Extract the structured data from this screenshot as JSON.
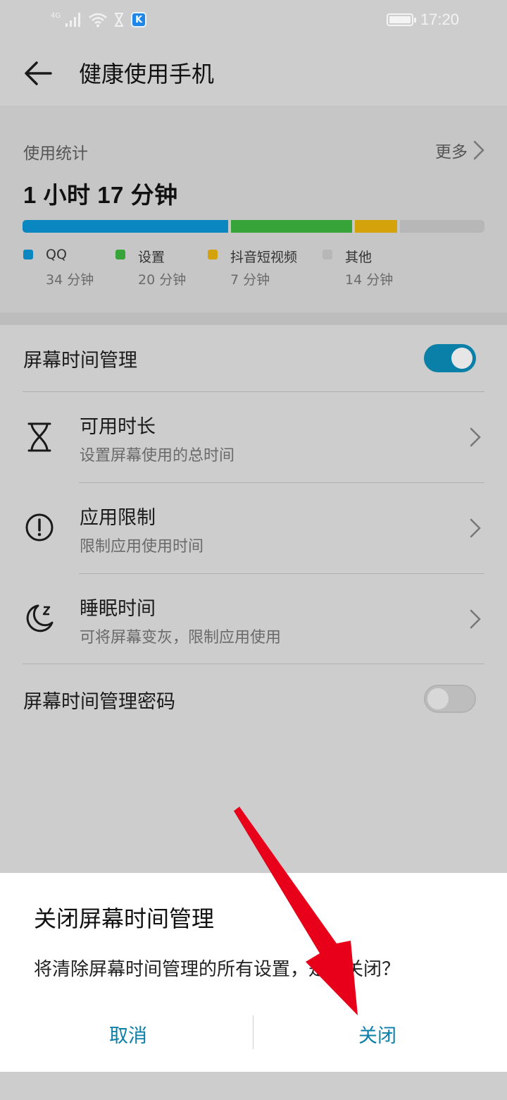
{
  "status_bar": {
    "network": "4G",
    "time": "17:20",
    "icons": [
      "signal-icon",
      "wifi-icon",
      "hourglass-icon",
      "k-app-icon",
      "battery-icon"
    ]
  },
  "header": {
    "title": "健康使用手机",
    "back_icon": "back-arrow-icon"
  },
  "usage": {
    "label": "使用统计",
    "more": "更多",
    "total": "1 小时 17 分钟",
    "apps": [
      {
        "name": "QQ",
        "time": "34 分钟",
        "minutes": 34,
        "color": "#0a86c0"
      },
      {
        "name": "设置",
        "time": "20 分钟",
        "minutes": 20,
        "color": "#37a43a"
      },
      {
        "name": "抖音短视频",
        "time": "7 分钟",
        "minutes": 7,
        "color": "#d4a20a"
      },
      {
        "name": "其他",
        "time": "14 分钟",
        "minutes": 14,
        "color": "#b7b7b7"
      }
    ]
  },
  "settings": {
    "screen_time": {
      "label": "屏幕时间管理",
      "enabled": true
    },
    "items": [
      {
        "title": "可用时长",
        "subtitle": "设置屏幕使用的总时间",
        "icon": "hourglass-icon"
      },
      {
        "title": "应用限制",
        "subtitle": "限制应用使用时间",
        "icon": "alert-circle-icon"
      },
      {
        "title": "睡眠时间",
        "subtitle": "可将屏幕变灰，限制应用使用",
        "icon": "moon-sleep-icon"
      }
    ],
    "password": {
      "label": "屏幕时间管理密码",
      "enabled": false
    }
  },
  "dialog": {
    "title": "关闭屏幕时间管理",
    "message": "将清除屏幕时间管理的所有设置，是否关闭？",
    "cancel": "取消",
    "confirm": "关闭"
  },
  "colors": {
    "accent": "#0a7fa8",
    "annotation_arrow": "#e8001a"
  }
}
